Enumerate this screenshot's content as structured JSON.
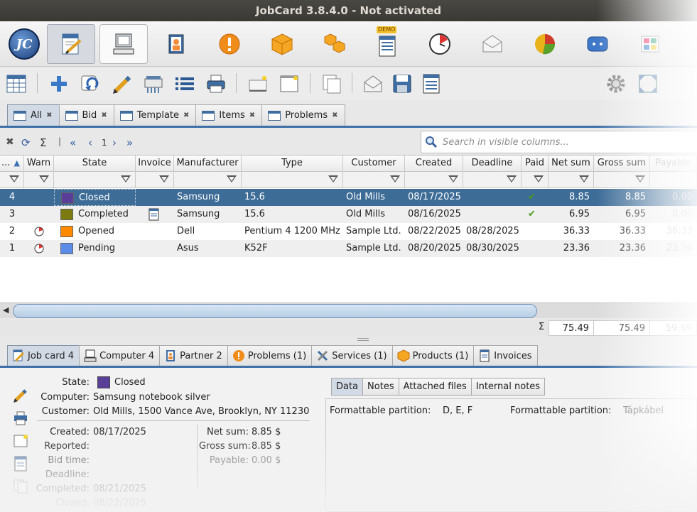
{
  "window": {
    "title": "JobCard 3.8.4.0 - Not activated"
  },
  "modules": [
    {
      "icon": "jobcard-logo-icon",
      "label": "JC"
    },
    {
      "icon": "jobcard-edit-icon",
      "active": true
    },
    {
      "icon": "computer-icon"
    },
    {
      "icon": "partner-icon"
    },
    {
      "icon": "warning-icon"
    },
    {
      "icon": "box-icon"
    },
    {
      "icon": "boxes-icon"
    },
    {
      "icon": "document-demo-icon",
      "badge": "DEMO"
    },
    {
      "icon": "clock-icon"
    },
    {
      "icon": "mail-icon"
    },
    {
      "icon": "pie-chart-icon"
    },
    {
      "icon": "chat-icon"
    },
    {
      "icon": "grid-color-icon"
    }
  ],
  "toolbar": [
    "table-icon",
    "add-icon",
    "copy-icon",
    "edit-pencil-icon",
    "print-icon",
    "list-icon",
    "printer-icon",
    "new-card-icon",
    "new-blank-icon",
    "duplicate-icon",
    "mail-open-icon",
    "save-icon",
    "report-icon",
    "settings-gear-icon",
    "fullscreen-icon"
  ],
  "tabs": [
    {
      "label": "All",
      "active": true
    },
    {
      "label": "Bid"
    },
    {
      "label": "Template"
    },
    {
      "label": "Items"
    },
    {
      "label": "Problems"
    }
  ],
  "pager": {
    "page": "1"
  },
  "search": {
    "placeholder": "Search in visible columns..."
  },
  "columns": [
    "...",
    "Warn",
    "State",
    "Invoice",
    "Manufacturer",
    "Type",
    "Customer",
    "Created",
    "Deadline",
    "Paid",
    "Net sum",
    "Gross sum",
    "Payable"
  ],
  "rows": [
    {
      "num": "4",
      "warn": false,
      "state": "Closed",
      "state_color": "#5a3f99",
      "invoice": false,
      "manufacturer": "Samsung",
      "type": "15.6",
      "customer": "Old Mills",
      "created": "08/17/2025",
      "deadline": "",
      "paid": true,
      "net": "8.85",
      "gross": "8.85",
      "payable": "0.00",
      "selected": true
    },
    {
      "num": "3",
      "warn": false,
      "state": "Completed",
      "state_color": "#7c7b0f",
      "invoice": true,
      "manufacturer": "Samsung",
      "type": "15.6",
      "customer": "Old Mills",
      "created": "08/16/2025",
      "deadline": "",
      "paid": true,
      "net": "6.95",
      "gross": "6.95",
      "payable": "0.00",
      "selected": false
    },
    {
      "num": "2",
      "warn": true,
      "state": "Opened",
      "state_color": "#ff8a00",
      "invoice": false,
      "manufacturer": "Dell",
      "type": "Pentium 4 1200 MHz",
      "customer": "Sample Ltd.",
      "created": "08/22/2025",
      "deadline": "08/28/2025",
      "paid": false,
      "net": "36.33",
      "gross": "36.33",
      "payable": "36.33",
      "selected": false
    },
    {
      "num": "1",
      "warn": true,
      "state": "Pending",
      "state_color": "#5b8de8",
      "invoice": false,
      "manufacturer": "Asus",
      "type": "K52F",
      "customer": "Sample Ltd.",
      "created": "08/20/2025",
      "deadline": "08/30/2025",
      "paid": false,
      "net": "23.36",
      "gross": "23.36",
      "payable": "23.36",
      "selected": false
    }
  ],
  "sum": {
    "symbol": "Σ",
    "net": "75.49",
    "gross": "75.49",
    "payable": "59.69"
  },
  "bottom_tabs": [
    {
      "label": "Job card 4",
      "icon": "jobcard-edit-icon",
      "active": true
    },
    {
      "label": "Computer 4",
      "icon": "computer-icon"
    },
    {
      "label": "Partner 2",
      "icon": "partner-icon"
    },
    {
      "label": "Problems (1)",
      "icon": "warning-icon"
    },
    {
      "label": "Services (1)",
      "icon": "tools-icon"
    },
    {
      "label": "Products (1)",
      "icon": "box-icon"
    },
    {
      "label": "Invoices",
      "icon": "document-icon"
    }
  ],
  "detail": {
    "state_label": "State:",
    "state_value": "Closed",
    "state_color": "#5a3f99",
    "computer_label": "Computer:",
    "computer_value": "Samsung notebook silver",
    "customer_label": "Customer:",
    "customer_value": "Old Mills, 1500 Vance Ave, Brooklyn, NY 11230",
    "created_label": "Created:",
    "created_value": "08/17/2025",
    "reported_label": "Reported:",
    "reported_value": "",
    "bidtime_label": "Bid time:",
    "bidtime_value": "",
    "deadline_label": "Deadline:",
    "deadline_value": "",
    "completed_label": "Completed:",
    "completed_value": "08/21/2025",
    "closed_label": "Closed:",
    "closed_value": "08/22/2025",
    "netsum_label": "Net sum:",
    "netsum_value": "8.85 $",
    "grosssum_label": "Gross sum:",
    "grosssum_value": "8.85 $",
    "payable_label": "Payable:",
    "payable_value": "0.00 $",
    "tabs": [
      "Data",
      "Notes",
      "Attached files",
      "Internal notes"
    ],
    "field1_label": "Formattable partition:",
    "field1_value": "D, E, F",
    "field2_label": "Formattable partition:",
    "field2_value": "Tápkábel"
  }
}
